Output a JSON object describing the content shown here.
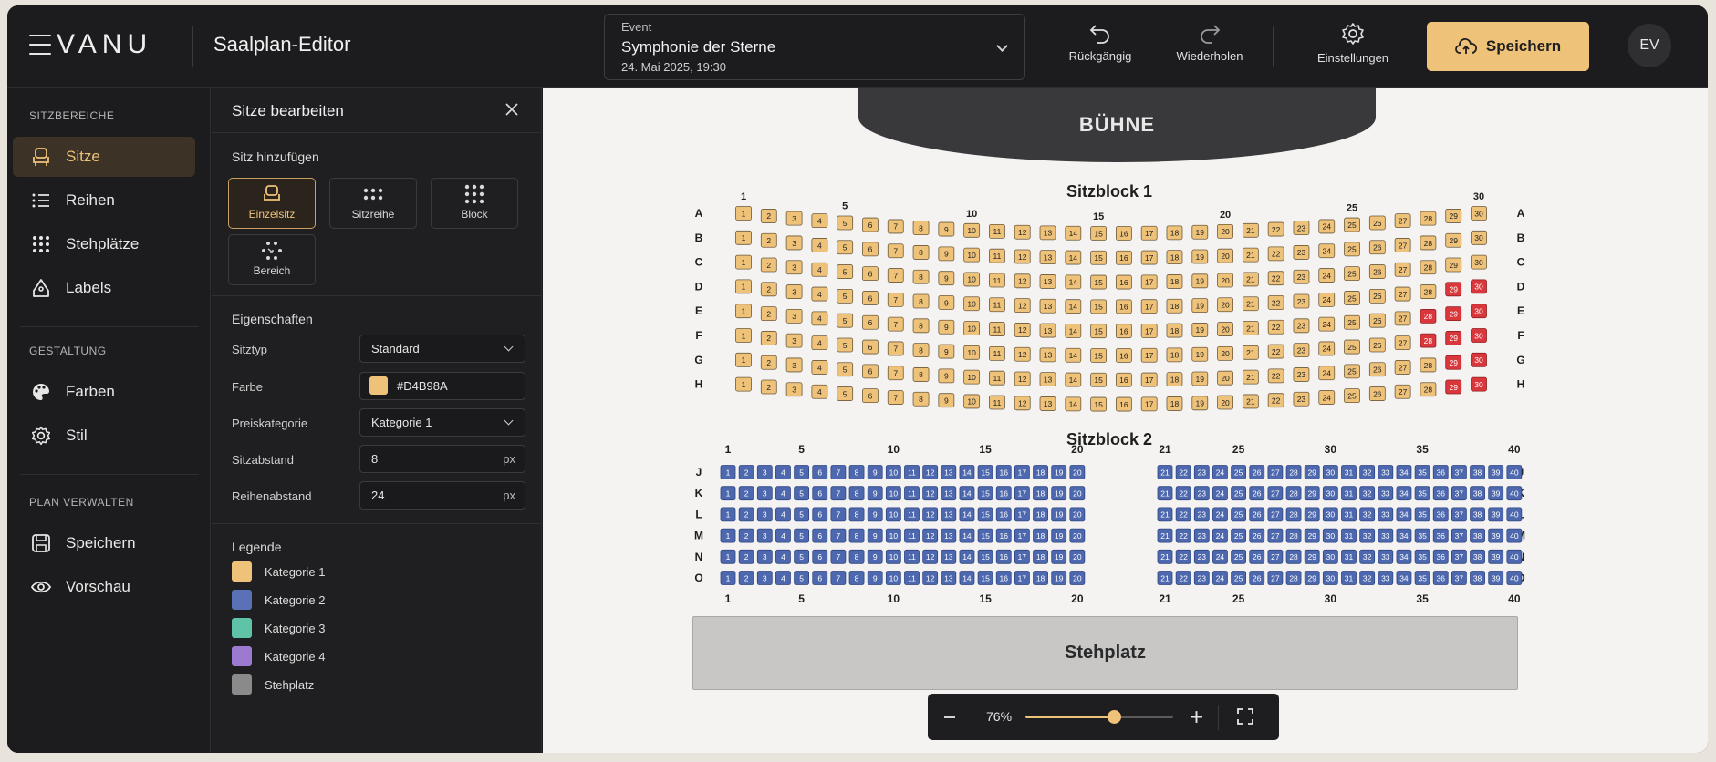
{
  "header": {
    "logo": "VANU",
    "app_title": "Saalplan-Editor",
    "event": {
      "label": "Event",
      "name": "Symphonie der Sterne",
      "datetime": "24. Mai 2025, 19:30"
    },
    "undo_label": "Rückgängig",
    "redo_label": "Wiederholen",
    "settings_label": "Einstellungen",
    "save_label": "Speichern",
    "avatar_initials": "EV"
  },
  "sidebar": {
    "sections": [
      {
        "title": "SITZBEREICHE",
        "items": [
          {
            "label": "Sitze",
            "icon": "seat-icon",
            "active": true
          },
          {
            "label": "Reihen",
            "icon": "list-icon"
          },
          {
            "label": "Stehplätze",
            "icon": "grid-icon"
          },
          {
            "label": "Labels",
            "icon": "tag-icon"
          }
        ]
      },
      {
        "title": "GESTALTUNG",
        "items": [
          {
            "label": "Farben",
            "icon": "palette-icon"
          },
          {
            "label": "Stil",
            "icon": "gear-icon"
          }
        ]
      },
      {
        "title": "PLAN VERWALTEN",
        "items": [
          {
            "label": "Speichern",
            "icon": "save-icon"
          },
          {
            "label": "Vorschau",
            "icon": "eye-icon"
          }
        ]
      }
    ]
  },
  "panel": {
    "title": "Sitze bearbeiten",
    "add_title": "Sitz hinzufügen",
    "add_buttons": [
      {
        "label": "Einzelsitz",
        "active": true
      },
      {
        "label": "Sitzreihe"
      },
      {
        "label": "Block"
      },
      {
        "label": "Bereich"
      }
    ],
    "props_title": "Eigenschaften",
    "props": {
      "seat_type": {
        "label": "Sitztyp",
        "value": "Standard"
      },
      "color": {
        "label": "Farbe",
        "value": "#D4B98A"
      },
      "price_category": {
        "label": "Preiskategorie",
        "value": "Kategorie 1"
      },
      "seat_spacing": {
        "label": "Sitzabstand",
        "value": "8",
        "unit": "px"
      },
      "row_spacing": {
        "label": "Reihenabstand",
        "value": "24",
        "unit": "px"
      }
    },
    "legend_title": "Legende",
    "legend": [
      {
        "label": "Kategorie 1",
        "color": "#EFC27A"
      },
      {
        "label": "Kategorie 2",
        "color": "#5A72B5"
      },
      {
        "label": "Kategorie 3",
        "color": "#5FC3A8"
      },
      {
        "label": "Kategorie 4",
        "color": "#9C7AD0"
      },
      {
        "label": "Stehplatz",
        "color": "#8A8A8A"
      }
    ]
  },
  "plan": {
    "stage_label": "BÜHNE",
    "block1": {
      "title": "Sitzblock 1",
      "rows": [
        "A",
        "B",
        "C",
        "D",
        "E",
        "F",
        "G",
        "H"
      ],
      "seats_per_row": 30,
      "column_markers": [
        "1",
        "5",
        "10",
        "15",
        "20",
        "25",
        "30"
      ],
      "seat_color": "#EFC27A",
      "highlighted_seats": [
        "D29",
        "D30",
        "E28",
        "E29",
        "E30",
        "F28",
        "F29",
        "F30",
        "G29",
        "G30",
        "H29",
        "H30"
      ],
      "highlight_color": "#D9373B"
    },
    "block2": {
      "title": "Sitzblock 2",
      "rows": [
        "J",
        "K",
        "L",
        "M",
        "N",
        "O"
      ],
      "left_seats": [
        "1",
        "2",
        "3",
        "4",
        "5",
        "6",
        "7",
        "8",
        "9",
        "10",
        "11",
        "12",
        "13",
        "14",
        "15",
        "16",
        "17",
        "18",
        "19",
        "20"
      ],
      "right_seats": [
        "21",
        "22",
        "23",
        "24",
        "25",
        "26",
        "27",
        "28",
        "29",
        "30",
        "31",
        "32",
        "33",
        "34",
        "35",
        "36",
        "37",
        "38",
        "39",
        "40"
      ],
      "left_markers": [
        "1",
        "5",
        "10",
        "15",
        "20"
      ],
      "right_markers": [
        "21",
        "25",
        "30",
        "35",
        "40"
      ],
      "seat_color": "#4D68AE"
    },
    "standing_label": "Stehplatz"
  },
  "zoom": {
    "value_label": "76%",
    "level": 0.6
  }
}
